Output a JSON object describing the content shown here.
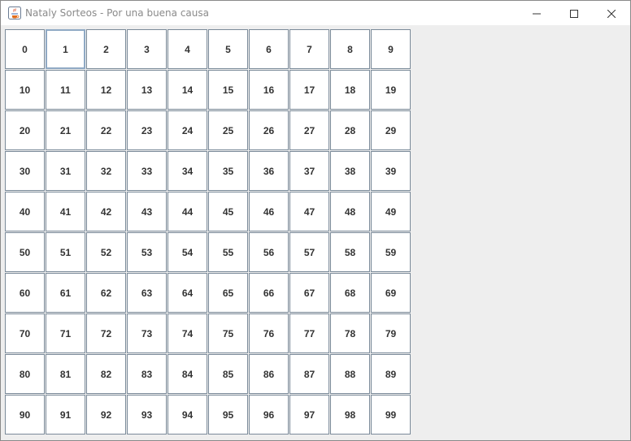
{
  "window": {
    "title": "Nataly Sorteos - Por una buena causa",
    "icon": "java-app-icon",
    "controls": [
      "minimize-icon",
      "maximize-icon",
      "close-icon"
    ]
  },
  "grid": {
    "focused_index": 1,
    "numbers": [
      "0",
      "1",
      "2",
      "3",
      "4",
      "5",
      "6",
      "7",
      "8",
      "9",
      "10",
      "11",
      "12",
      "13",
      "14",
      "15",
      "16",
      "17",
      "18",
      "19",
      "20",
      "21",
      "22",
      "23",
      "24",
      "25",
      "26",
      "27",
      "28",
      "29",
      "30",
      "31",
      "32",
      "33",
      "34",
      "35",
      "36",
      "37",
      "38",
      "39",
      "40",
      "41",
      "42",
      "43",
      "44",
      "45",
      "46",
      "47",
      "48",
      "49",
      "50",
      "51",
      "52",
      "53",
      "54",
      "55",
      "56",
      "57",
      "58",
      "59",
      "60",
      "61",
      "62",
      "63",
      "64",
      "65",
      "66",
      "67",
      "68",
      "69",
      "70",
      "71",
      "72",
      "73",
      "74",
      "75",
      "76",
      "77",
      "78",
      "79",
      "80",
      "81",
      "82",
      "83",
      "84",
      "85",
      "86",
      "87",
      "88",
      "89",
      "90",
      "91",
      "92",
      "93",
      "94",
      "95",
      "96",
      "97",
      "98",
      "99"
    ]
  },
  "colors": {
    "button_border": "#7a8a99",
    "focus_border": "#8fa9c4",
    "panel_bg": "#eeeeee"
  }
}
